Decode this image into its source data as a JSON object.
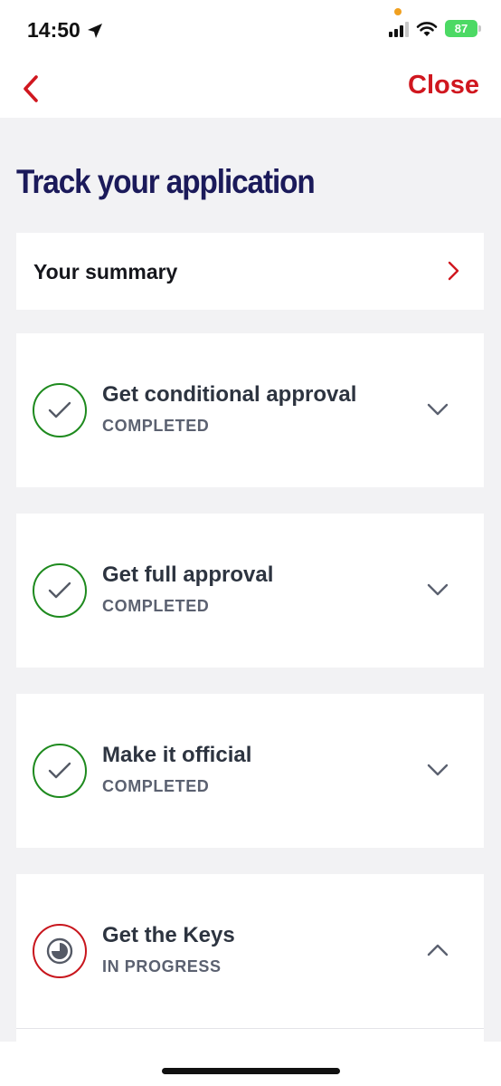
{
  "status_bar": {
    "time": "14:50",
    "battery": "87"
  },
  "nav": {
    "close_label": "Close"
  },
  "page": {
    "title": "Track your application"
  },
  "summary": {
    "label": "Your summary"
  },
  "steps": [
    {
      "title": "Get conditional approval",
      "status": "COMPLETED",
      "state": "completed",
      "expanded": false
    },
    {
      "title": "Get full approval",
      "status": "COMPLETED",
      "state": "completed",
      "expanded": false
    },
    {
      "title": "Make it official",
      "status": "COMPLETED",
      "state": "completed",
      "expanded": false
    },
    {
      "title": "Get the Keys",
      "status": "IN PROGRESS",
      "state": "in-progress",
      "expanded": true
    }
  ],
  "colors": {
    "accent_red": "#d0171f",
    "title_navy": "#1b1a5a",
    "completed_green": "#1e8a1e",
    "background": "#f2f2f4"
  }
}
